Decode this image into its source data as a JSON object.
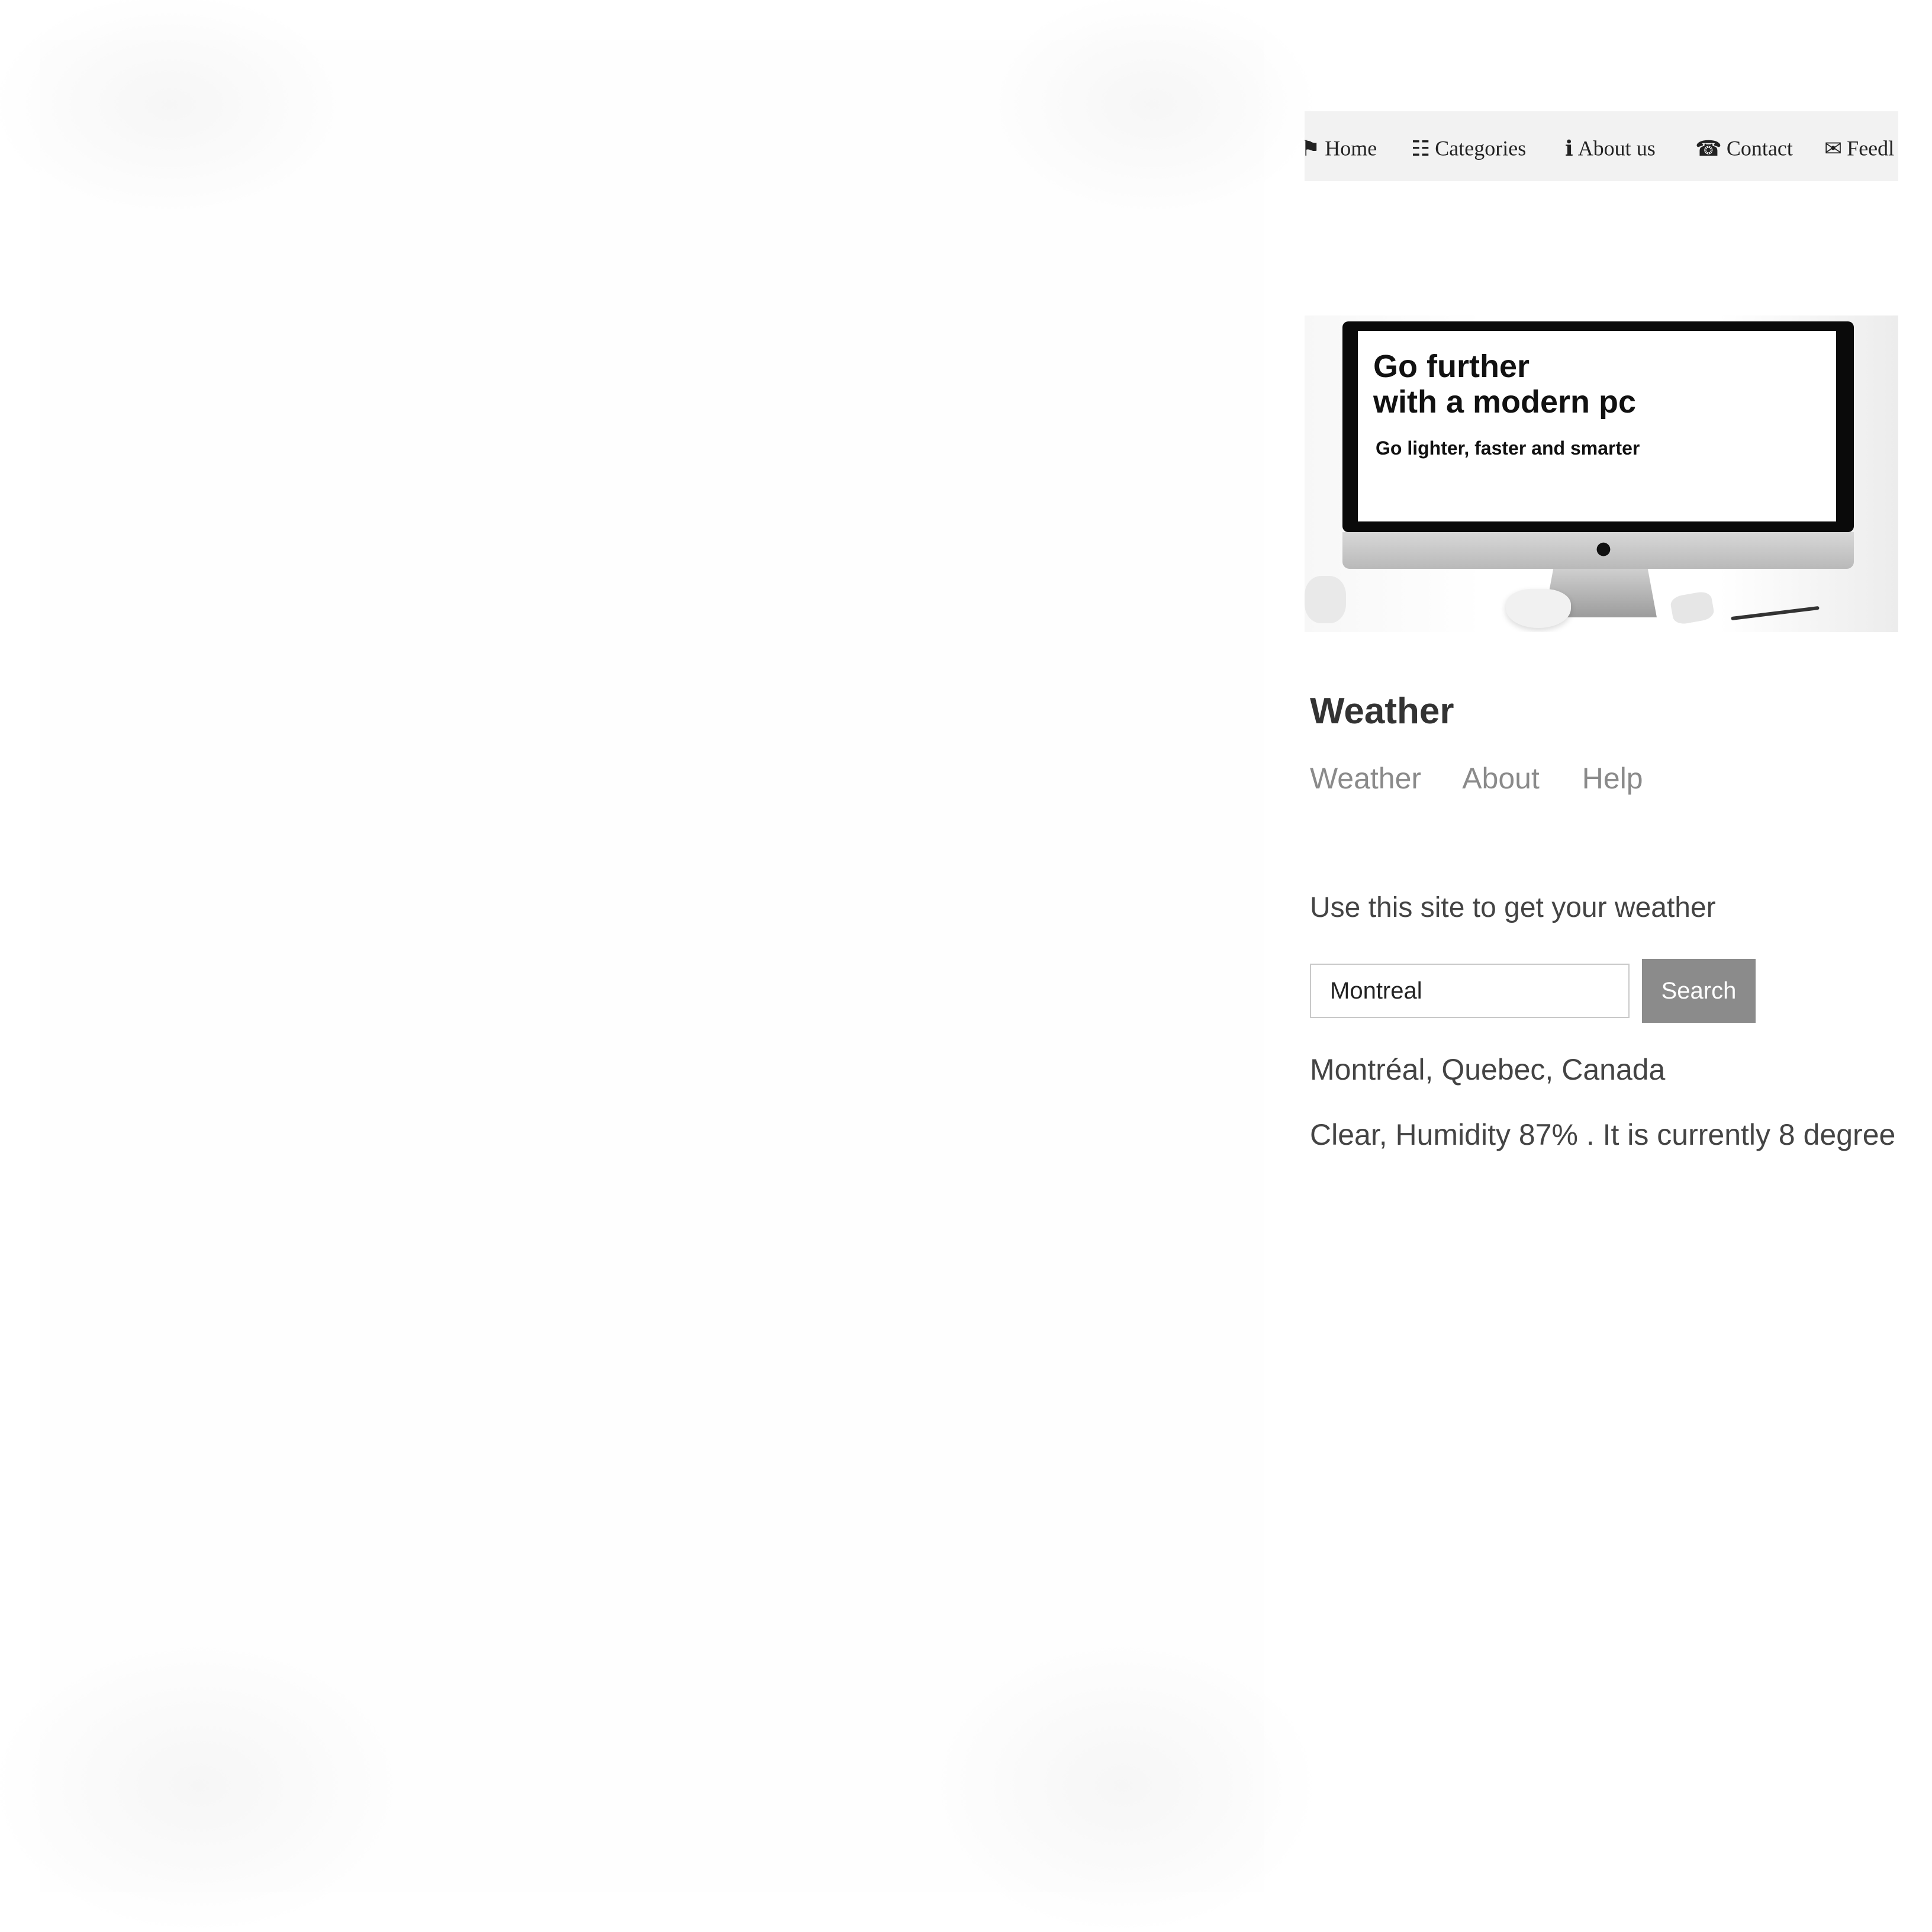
{
  "topnav": {
    "items": [
      {
        "label": "Home",
        "icon": "home-icon",
        "glyph": "⚑"
      },
      {
        "label": "Categories",
        "icon": "list-icon",
        "glyph": "☷"
      },
      {
        "label": "About us",
        "icon": "info-icon",
        "glyph": "ℹ"
      },
      {
        "label": "Contact",
        "icon": "phone-icon",
        "glyph": "☎"
      },
      {
        "label": "Feedl",
        "icon": "chat-icon",
        "glyph": "✉"
      }
    ]
  },
  "hero": {
    "title": "Go further\nwith a modern pc",
    "subtitle": "Go lighter, faster and smarter"
  },
  "app": {
    "title": "Weather",
    "nav": [
      "Weather",
      "About",
      "Help"
    ],
    "intro": "Use this site to get your weather",
    "search": {
      "value": "Montreal",
      "button_label": "Search"
    },
    "location": "Montréal, Quebec, Canada",
    "forecast": "Clear, Humidity 87% . It is currently 8 degree"
  },
  "colors": {
    "nav_bg": "#f2f2f2",
    "button_bg": "#8b8b8b",
    "link_color": "#8a8a8a",
    "text_color": "#444444"
  }
}
